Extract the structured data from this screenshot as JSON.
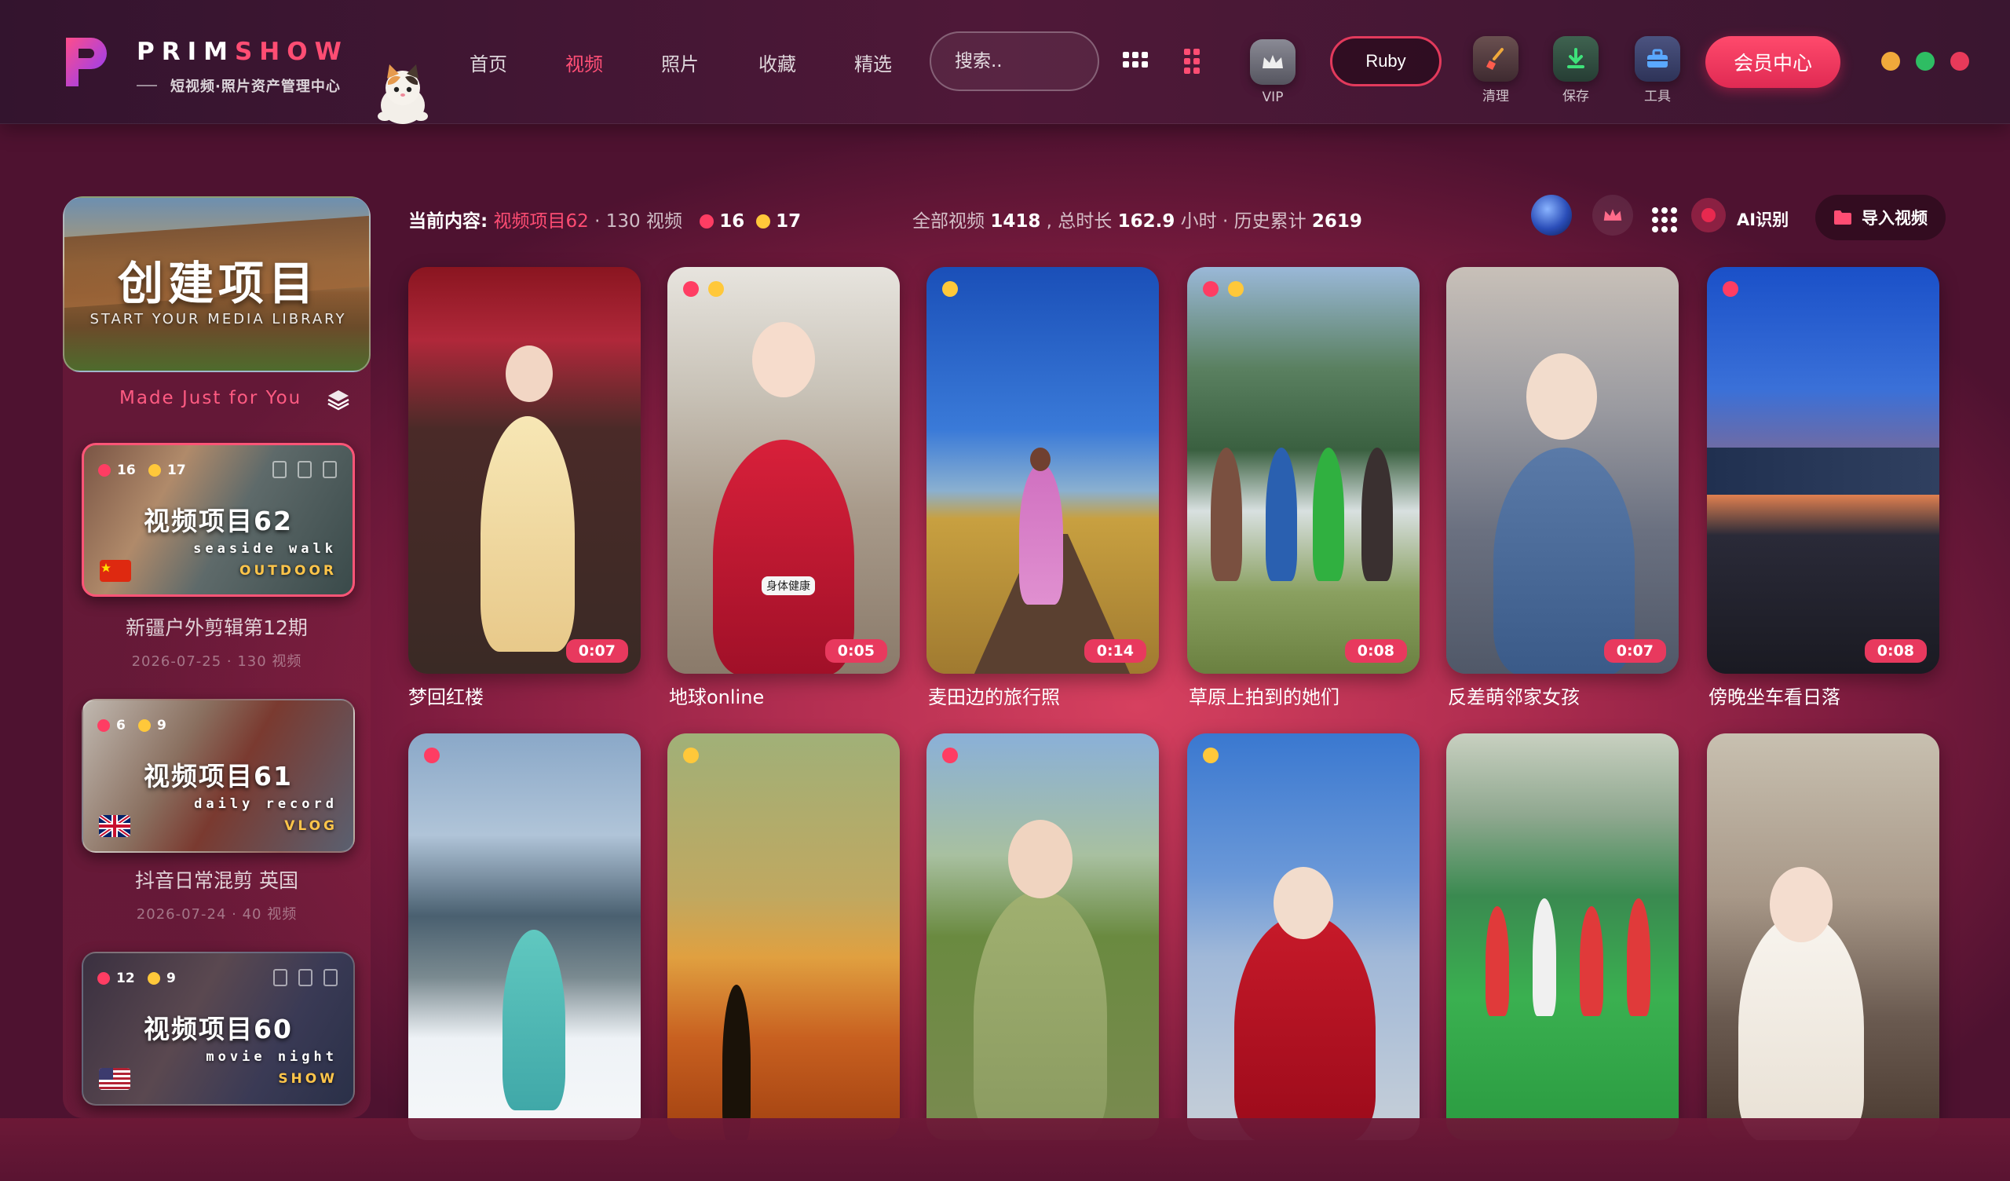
{
  "brand": {
    "part1": "PRIM",
    "part2": "SHOW",
    "subtitle": "短视频·照片资产管理中心"
  },
  "nav": [
    {
      "label": "首页",
      "active": false
    },
    {
      "label": "视频",
      "active": true
    },
    {
      "label": "照片",
      "active": false
    },
    {
      "label": "收藏",
      "active": false
    },
    {
      "label": "精选",
      "active": false
    }
  ],
  "search": {
    "placeholder": "搜索.."
  },
  "toolbar": {
    "vip_label": "VIP",
    "ruby_label": "Ruby",
    "clean_label": "清理",
    "save_label": "保存",
    "tools_label": "工具",
    "member_label": "会员中心"
  },
  "colors": {
    "accent": "#ff4d73",
    "orange_dot": "#f0a93b",
    "green_dot": "#2ebd63",
    "red_dot": "#e83a5a"
  },
  "sidebar": {
    "create_title": "创建项目",
    "create_subtitle": "START YOUR MEDIA LIBRARY",
    "tagline": "Made Just for You",
    "projects": [
      {
        "title": "视频项目62",
        "sub1": "seaside walk",
        "sub2": "OUTDOOR",
        "red": "16",
        "yellow": "17",
        "name": "新疆户外剪辑第12期",
        "meta": "2026-07-25 · 130 视频",
        "flag": "cn-flag"
      },
      {
        "title": "视频项目61",
        "sub1": "daily record",
        "sub2": "VLOG",
        "red": "6",
        "yellow": "9",
        "name": "抖音日常混剪 英国",
        "meta": "2026-07-24 · 40 视频",
        "flag": "uk-flag"
      },
      {
        "title": "视频项目60",
        "sub1": "movie night",
        "sub2": "SHOW",
        "red": "12",
        "yellow": "9",
        "name": "",
        "meta": "",
        "flag": "us-flag"
      }
    ]
  },
  "info": {
    "label": "当前内容:",
    "project": "视频项目62",
    "count": "· 130 视频",
    "red": "16",
    "yellow": "17",
    "all_label": "全部视频",
    "all_value": "1418",
    "dur_label": ", 总时长",
    "dur_value": "162.9",
    "dur_unit": "小时 · 历史累计",
    "history_value": "2619"
  },
  "actions": {
    "ai_label": "AI识别",
    "import_label": "导入视频"
  },
  "videos": [
    {
      "title": "梦回红楼",
      "duration": "0:07"
    },
    {
      "title": "地球online",
      "duration": "0:05"
    },
    {
      "title": "麦田边的旅行照",
      "duration": "0:14"
    },
    {
      "title": "草原上拍到的她们",
      "duration": "0:08"
    },
    {
      "title": "反差萌邻家女孩",
      "duration": "0:07"
    },
    {
      "title": "傍晚坐车看日落",
      "duration": "0:08"
    }
  ],
  "overlay_text": "身体健康"
}
